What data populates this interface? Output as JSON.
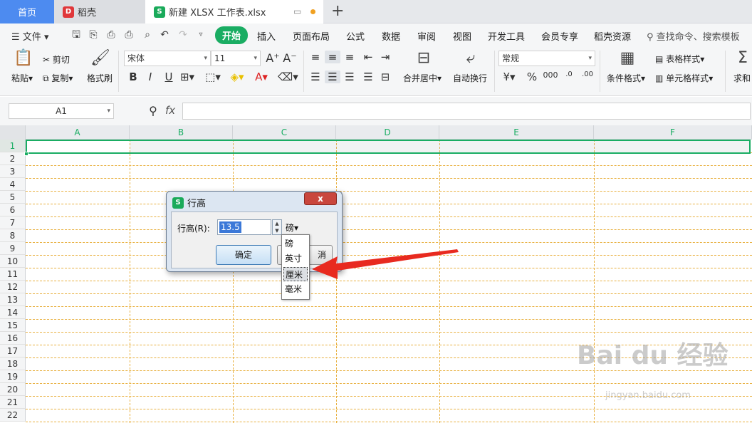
{
  "tabs": {
    "home": "首页",
    "daoke": "稻壳",
    "file": "新建 XLSX 工作表.xlsx"
  },
  "menu": {
    "file": "文件",
    "tabs": [
      "开始",
      "插入",
      "页面布局",
      "公式",
      "数据",
      "审阅",
      "视图",
      "开发工具",
      "会员专享",
      "稻壳资源"
    ],
    "search": "查找命令、搜索模板"
  },
  "ribbon": {
    "paste": "粘贴",
    "cut": "剪切",
    "copy": "复制",
    "format_painter": "格式刷",
    "font_name": "宋体",
    "font_size": "11",
    "merge_center": "合并居中",
    "wrap": "自动换行",
    "number_format": "常规",
    "cond_format": "条件格式",
    "table_style": "表格样式",
    "cell_style": "单元格样式",
    "sum": "求和"
  },
  "formula_bar": {
    "name_box": "A1",
    "fx": "fx"
  },
  "grid": {
    "columns": [
      "A",
      "B",
      "C",
      "D",
      "E",
      "F"
    ],
    "rows": [
      "1",
      "2",
      "3",
      "4",
      "5",
      "6",
      "7",
      "8",
      "9",
      "10",
      "11",
      "12",
      "13",
      "14",
      "15",
      "16",
      "17",
      "18",
      "19",
      "20",
      "21",
      "22"
    ]
  },
  "dialog": {
    "title": "行高",
    "label": "行高(R):",
    "value": "13.5",
    "unit": "磅",
    "ok": "确定",
    "cancel_visible": "消",
    "close": "x",
    "units": [
      "磅",
      "英寸",
      "厘米",
      "毫米"
    ]
  },
  "watermark": {
    "main": "Bai du 经验",
    "sub": "jingyan.baidu.com"
  }
}
